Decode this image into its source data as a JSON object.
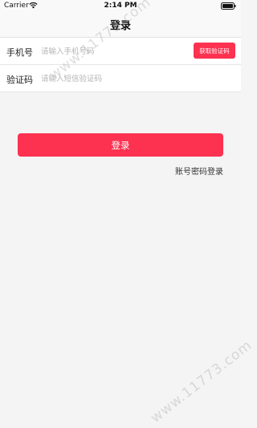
{
  "status_bar": {
    "carrier": "Carrier",
    "time": "2:14 PM"
  },
  "nav": {
    "title": "登录"
  },
  "form": {
    "phone": {
      "label": "手机号",
      "placeholder": "请输入手机号码"
    },
    "get_code_label": "获取验证码",
    "code": {
      "label": "验证码",
      "placeholder": "请输入短信验证码"
    }
  },
  "login_label": "登录",
  "alt_login_label": "账号密码登录",
  "watermark": {
    "text": "www.11773.com"
  },
  "colors": {
    "accent": "#fd3150",
    "background": "#f4f4f4"
  },
  "icons": {
    "wifi": "wifi-icon",
    "battery": "battery-icon"
  }
}
